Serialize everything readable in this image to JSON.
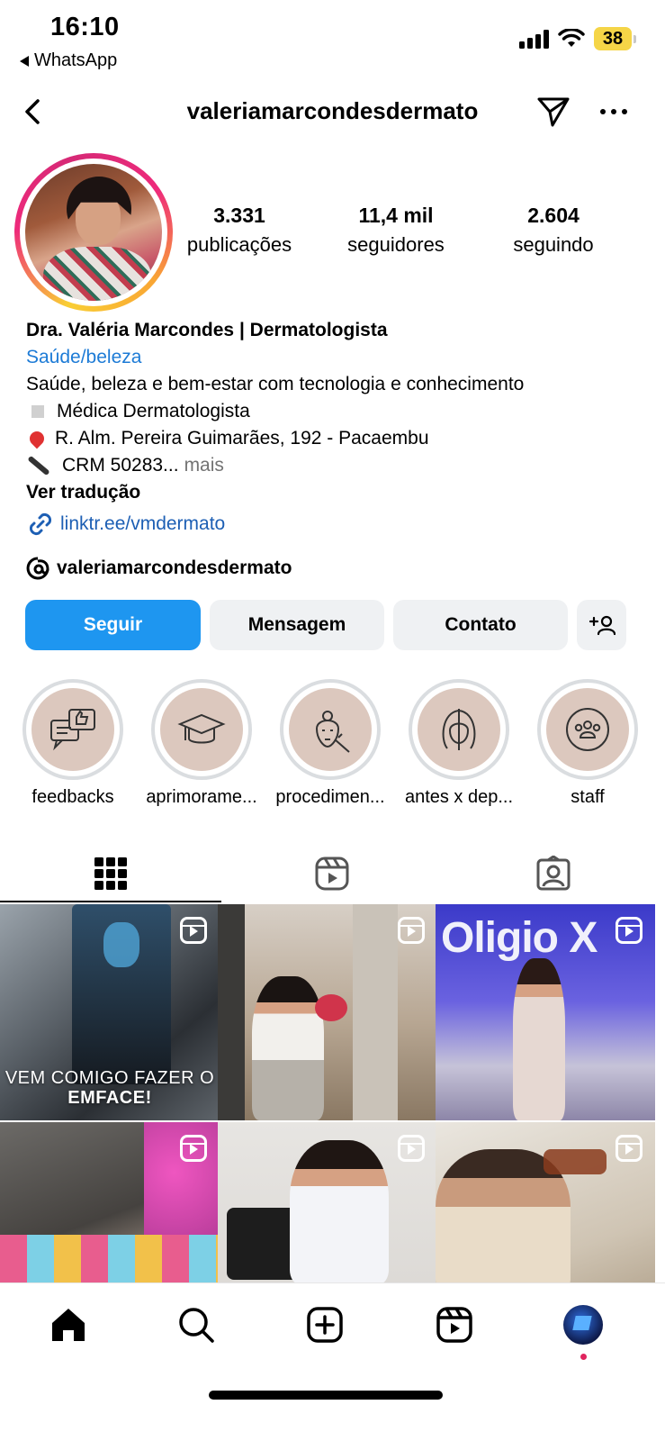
{
  "status_bar": {
    "time": "16:10",
    "back_app": "WhatsApp",
    "battery": "38",
    "colors": {
      "battery": "#f5d547"
    }
  },
  "header": {
    "username": "valeriamarcondesdermato",
    "icons": [
      "back-chevron-icon",
      "send-icon",
      "more-icon"
    ]
  },
  "profile": {
    "stats": [
      {
        "value": "3.331",
        "label": "publicações"
      },
      {
        "value": "11,4 mil",
        "label": "seguidores"
      },
      {
        "value": "2.604",
        "label": "seguindo"
      }
    ],
    "name": "Dra. Valéria Marcondes | Dermatologista",
    "category": "Saúde/beleza",
    "bio_lines": [
      "Saúde, beleza e bem-estar com tecnologia e conhecimento",
      "Médica Dermatologista",
      "R. Alm. Pereira Guimarães, 192 - Pacaembu",
      "CRM 50283..."
    ],
    "more": "mais",
    "translate": "Ver tradução",
    "link": "linktr.ee/vmdermato",
    "threads_handle": "valeriamarcondesdermato"
  },
  "actions": {
    "follow": "Seguir",
    "message": "Mensagem",
    "contact": "Contato",
    "colors": {
      "follow": "#1e96f0"
    }
  },
  "highlights": [
    {
      "label": "feedbacks",
      "icon": "chat-thumbs-up-icon"
    },
    {
      "label": "aprimorame...",
      "icon": "graduation-cap-icon"
    },
    {
      "label": "procedimen...",
      "icon": "face-injection-icon"
    },
    {
      "label": "antes x dep...",
      "icon": "before-after-face-icon"
    },
    {
      "label": "staff",
      "icon": "group-icon"
    }
  ],
  "tabs": [
    {
      "name": "posts",
      "icon": "grid-icon",
      "active": true
    },
    {
      "name": "reels",
      "icon": "reels-icon",
      "active": false
    },
    {
      "name": "tagged",
      "icon": "tagged-person-icon",
      "active": false
    }
  ],
  "posts": [
    {
      "caption_regular": "VEM COMIGO FAZER O",
      "caption_bold": "EMFACE!",
      "is_reel": true
    },
    {
      "is_reel": true
    },
    {
      "brand": "Oligio X",
      "is_reel": true
    },
    {
      "is_reel": true
    },
    {
      "is_reel": true
    },
    {
      "is_reel": true
    }
  ],
  "bottom_nav": [
    "home-icon",
    "search-icon",
    "create-icon",
    "reels-icon",
    "profile-avatar"
  ]
}
